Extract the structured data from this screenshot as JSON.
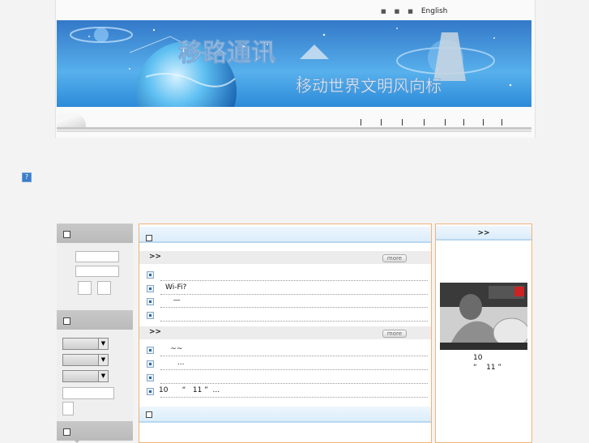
{
  "header": {
    "top_links": [
      "■",
      "■",
      "■",
      "English"
    ],
    "banner_title": "移路通讯",
    "banner_slogan": "移动世界文明风向标"
  },
  "nav": {
    "separators": [
      "|",
      "|",
      "|",
      "|",
      "|",
      "|",
      "|",
      "|"
    ]
  },
  "help_icon": "?",
  "left_panel": {
    "sections": [
      {
        "title": ""
      },
      {
        "title": ""
      },
      {
        "title": ""
      }
    ]
  },
  "main": {
    "sections": [
      {
        "heading": ">>",
        "more_label": "more",
        "items": [
          "",
          "Wi-Fi?",
          "  —",
          ""
        ]
      },
      {
        "heading": ">>",
        "more_label": "more",
        "items": [
          "     ~~",
          "        ...",
          "",
          "10      “   11 ”  ..."
        ]
      }
    ]
  },
  "right_panel": {
    "heading": ">>",
    "caption_line1": "10",
    "caption_line2": "“    11 ”"
  }
}
